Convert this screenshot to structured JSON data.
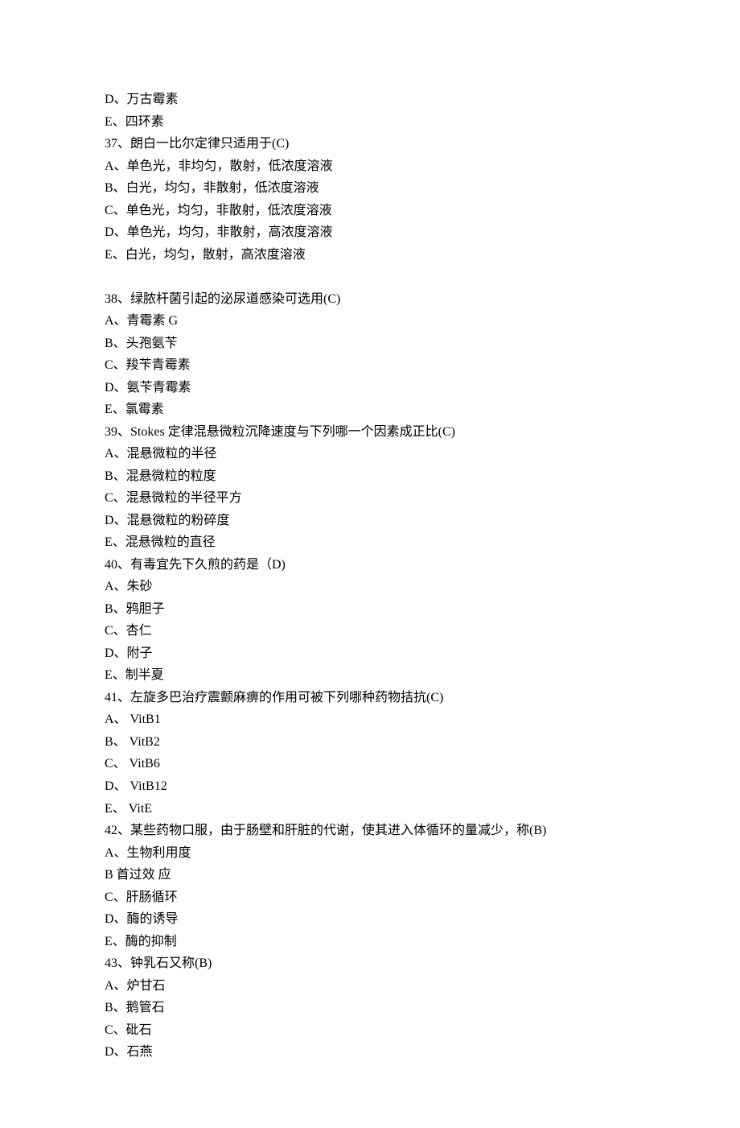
{
  "lines": [
    "D、万古霉素",
    "E、四环素",
    "37、朗白一比尔定律只适用于(C)",
    "A、单色光，非均匀，散射，低浓度溶液",
    "B、白光，均匀，非散射，低浓度溶液",
    "C、单色光，均匀，非散射，低浓度溶液",
    "D、单色光，均匀，非散射，高浓度溶液",
    "E、白光，均匀，散射，高浓度溶液",
    "",
    "38、绿脓杆菌引起的泌尿道感染可选用(C)",
    "A、青霉素 G",
    "B、头孢氨苄",
    "C、羧苄青霉素",
    "D、氨苄青霉素",
    "E、氯霉素",
    "39、Stokes 定律混悬微粒沉降速度与下列哪一个因素成正比(C)",
    "A、混悬微粒的半径",
    "B、混悬微粒的粒度",
    "C、混悬微粒的半径平方",
    "D、混悬微粒的粉碎度",
    "E、混悬微粒的直径",
    "40、有毒宜先下久煎的药是（D)",
    "A、朱砂",
    "B、鸦胆子",
    "C、杏仁",
    "D、附子",
    "E、制半夏",
    "41、左旋多巴治疗震颤麻痹的作用可被下列哪种药物拮抗(C)",
    "A、 VitB1",
    "B、 VitB2",
    "C、 VitB6",
    "D、 VitB12",
    "E、 VitE",
    "42、某些药物口服，由于肠壁和肝脏的代谢，使其进入体循环的量减少，称(B)",
    "A、生物利用度",
    "B 首过效 应",
    "C、肝肠循环",
    "D、酶的诱导",
    "E、酶的抑制",
    "43、钟乳石又称(B)",
    "A、炉甘石",
    "B、鹅管石",
    "C、砒石",
    "D、石燕"
  ]
}
